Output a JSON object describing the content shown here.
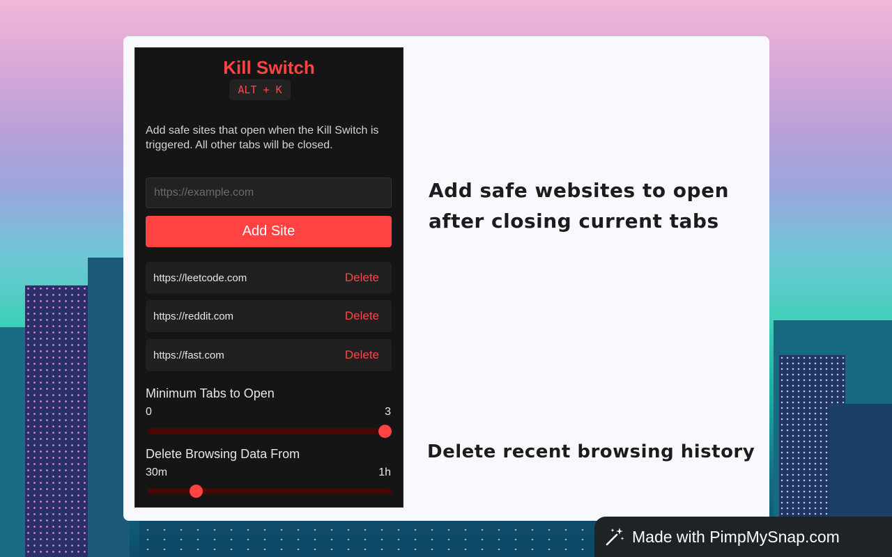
{
  "popup": {
    "title": "Kill Switch",
    "shortcut": "ALT + K",
    "description": "Add safe sites that open when the Kill Switch is triggered. All other tabs will be closed.",
    "input_placeholder": "https://example.com",
    "input_value": "",
    "add_button_label": "Add Site",
    "sites": [
      {
        "url": "https://leetcode.com",
        "action": "Delete"
      },
      {
        "url": "https://reddit.com",
        "action": "Delete"
      },
      {
        "url": "https://fast.com",
        "action": "Delete"
      }
    ],
    "min_tabs": {
      "label": "Minimum Tabs to Open",
      "min": "0",
      "max": "3",
      "value_fraction": 1.0
    },
    "delete_data": {
      "label": "Delete Browsing Data From",
      "min": "30m",
      "max": "1h",
      "value_fraction": 0.18
    }
  },
  "captions": {
    "top": "Add safe websites to open after closing current tabs",
    "bottom": "Delete recent browsing history"
  },
  "badge": {
    "text": "Made with PimpMySnap.com",
    "icon": "magic-wand-icon"
  },
  "colors": {
    "accent": "#ff4242",
    "popup_bg": "#151515",
    "card_bg": "#f7f9fc",
    "track": "#4a0505"
  }
}
